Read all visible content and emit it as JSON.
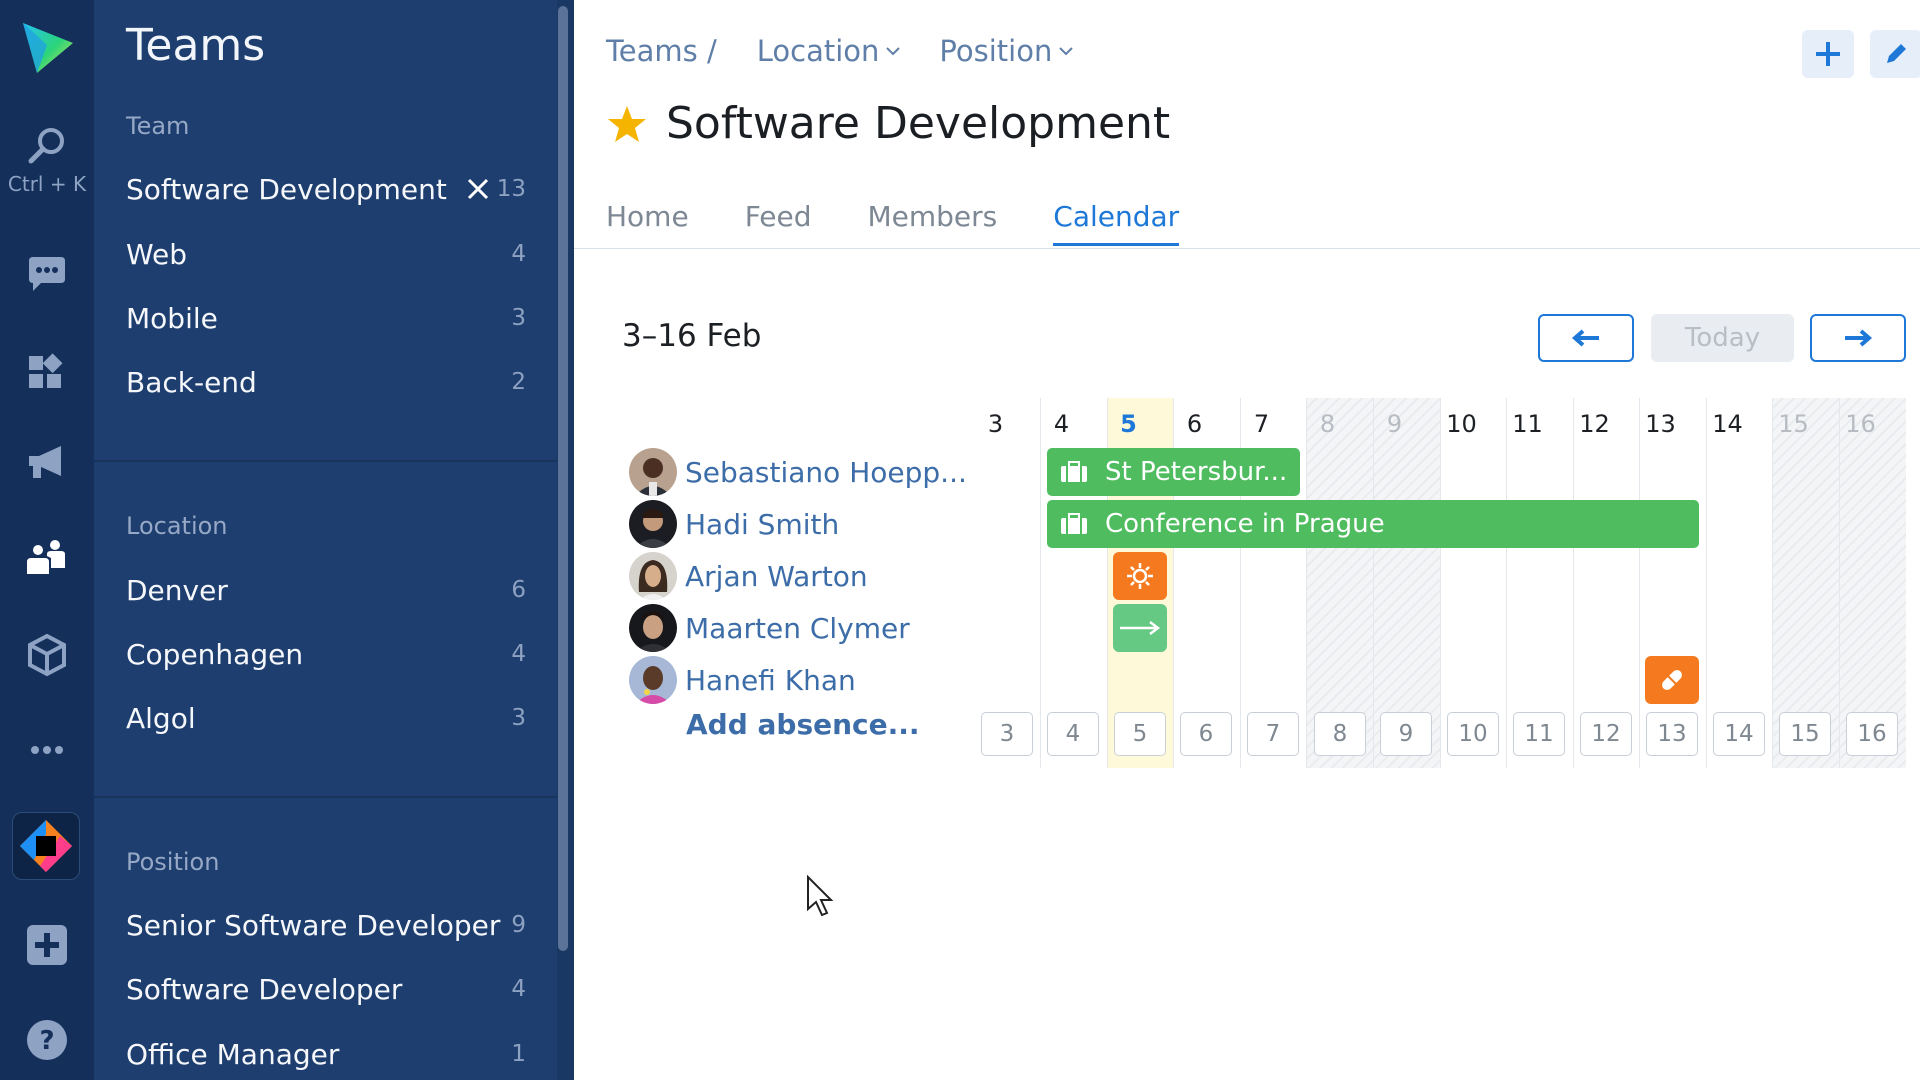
{
  "rail": {
    "search_hint": "Ctrl + K"
  },
  "sidebar": {
    "title": "Teams",
    "team_section": "Team",
    "teams": [
      {
        "label": "Software Development",
        "count": "13"
      },
      {
        "label": "Web",
        "count": "4"
      },
      {
        "label": "Mobile",
        "count": "3"
      },
      {
        "label": "Back-end",
        "count": "2"
      }
    ],
    "location_section": "Location",
    "locations": [
      {
        "label": "Denver",
        "count": "6"
      },
      {
        "label": "Copenhagen",
        "count": "4"
      },
      {
        "label": "Algol",
        "count": "3"
      }
    ],
    "position_section": "Position",
    "positions": [
      {
        "label": "Senior Software Developer",
        "count": "9"
      },
      {
        "label": "Software Developer",
        "count": "4"
      },
      {
        "label": "Office Manager",
        "count": "1"
      }
    ]
  },
  "header": {
    "breadcrumb_root": "Teams /",
    "filter_location": "Location",
    "filter_position": "Position",
    "title": "Software Development"
  },
  "tabs": [
    {
      "label": "Home"
    },
    {
      "label": "Feed"
    },
    {
      "label": "Members"
    },
    {
      "label": "Calendar"
    }
  ],
  "calendar": {
    "range": "3–16 Feb",
    "today_label": "Today",
    "days": [
      "3",
      "4",
      "5",
      "6",
      "7",
      "8",
      "9",
      "10",
      "11",
      "12",
      "13",
      "14",
      "15",
      "16"
    ],
    "weekend_days": [
      "8",
      "9",
      "15",
      "16"
    ],
    "today": "5",
    "people": [
      {
        "name": "Sebastiano Hoepp..."
      },
      {
        "name": "Hadi Smith"
      },
      {
        "name": "Arjan Warton"
      },
      {
        "name": "Maarten Clymer"
      },
      {
        "name": "Hanefi Khan"
      }
    ],
    "events": [
      {
        "person": "Sebastiano Hoepp...",
        "label": "St Petersbur...",
        "type": "business-trip",
        "start": "4",
        "end": "7"
      },
      {
        "person": "Hadi Smith",
        "label": "Conference in Prague",
        "type": "business-trip",
        "start": "4",
        "end": "13"
      },
      {
        "person": "Arjan Warton",
        "type": "vacation",
        "start": "5",
        "end": "5"
      },
      {
        "person": "Maarten Clymer",
        "type": "working-remotely",
        "start": "5",
        "end": "5"
      },
      {
        "person": "Hanefi Khan",
        "type": "sick-leave",
        "start": "13",
        "end": "13"
      }
    ],
    "add_absence": "Add absence..."
  },
  "colors": {
    "rail_bg": "#14305a",
    "sidebar_bg": "#1d3e6e",
    "accent": "#1e78d8",
    "event_green": "#4fbd5f",
    "event_orange": "#f57a1f",
    "star": "#f5b400"
  }
}
